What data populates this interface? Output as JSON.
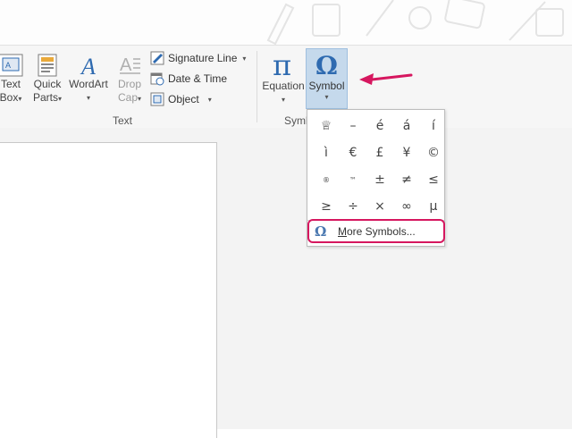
{
  "ribbon": {
    "text_box": {
      "line1": "Text",
      "line2": "Box"
    },
    "quick_parts": {
      "line1": "Quick",
      "line2": "Parts"
    },
    "wordart": {
      "label": "WordArt"
    },
    "drop_cap": {
      "line1": "Drop",
      "line2": "Cap"
    },
    "signature_line": "Signature Line",
    "date_time": "Date & Time",
    "object": "Object",
    "group_text": "Text",
    "equation": "Equation",
    "symbol": "Symbol",
    "group_symbols": "Symb"
  },
  "symbols": {
    "row1": [
      "♕",
      "–",
      "é",
      "á",
      "í"
    ],
    "row2": [
      "ì",
      "€",
      "£",
      "¥",
      "©"
    ],
    "row3": [
      "®",
      "™",
      "±",
      "≠",
      "≤"
    ],
    "row4": [
      "≥",
      "÷",
      "×",
      "∞",
      "µ"
    ]
  },
  "more_symbols": {
    "prefix": "M",
    "rest": "ore Symbols..."
  },
  "colors": {
    "accent": "#d6175f",
    "ribbon_bg": "#f6f6f6",
    "symbol_highlight": "#c5d9ec",
    "icon_blue": "#2e6ab0"
  }
}
